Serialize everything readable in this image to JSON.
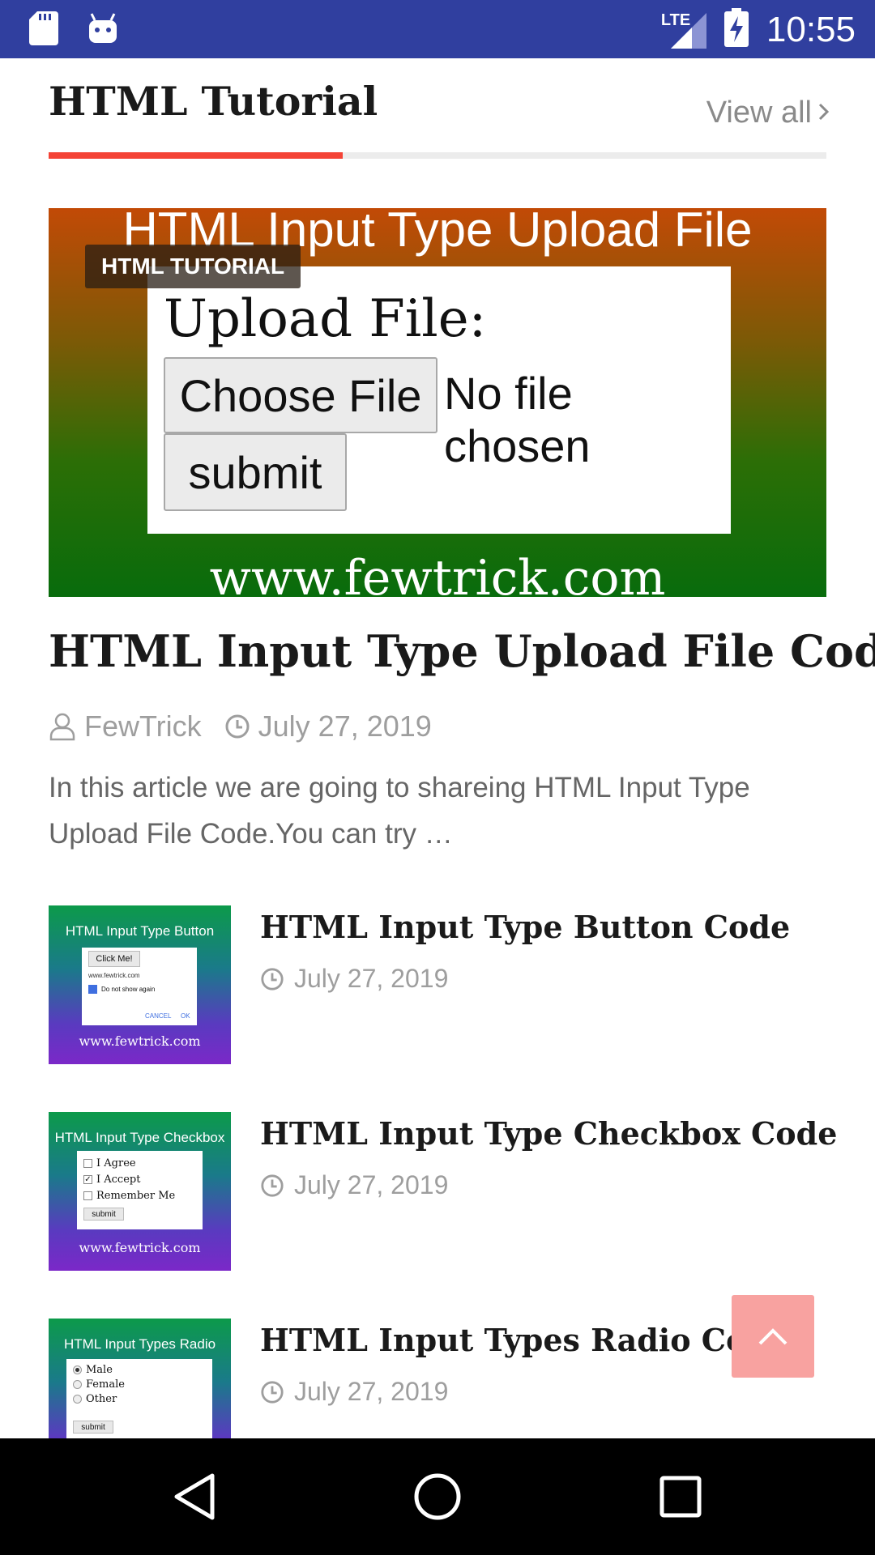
{
  "status_bar": {
    "time": "10:55",
    "network": "LTE"
  },
  "section": {
    "title": "HTML Tutorial",
    "view_all": "View all"
  },
  "featured": {
    "image": {
      "top_text": "HTML Input Type Upload File",
      "label": "Upload File:",
      "choose_button": "Choose File",
      "no_file": "No file chosen",
      "submit": "submit",
      "site": "www.fewtrick.com"
    },
    "category": "HTML TUTORIAL",
    "title": "HTML Input Type Upload File Code",
    "author": "FewTrick",
    "date": "July 27, 2019",
    "excerpt": "In this article we are going to shareing HTML Input Type Upload File Code.You can try …"
  },
  "posts": [
    {
      "title": "HTML Input Type Button Code",
      "date": "July 27, 2019",
      "thumb": {
        "title": "HTML Input Type Button",
        "button": "Click Me!",
        "site_small": "www.fewtrick.com",
        "check_label": "Do not show again",
        "cancel": "CANCEL",
        "ok": "OK",
        "site": "www.fewtrick.com"
      }
    },
    {
      "title": "HTML Input Type Checkbox Code",
      "date": "July 27, 2019",
      "thumb": {
        "title": "HTML Input Type Checkbox",
        "options": [
          "I Agree",
          "I Accept",
          "Remember Me"
        ],
        "submit": "submit",
        "site": "www.fewtrick.com"
      }
    },
    {
      "title": "HTML Input Types Radio Code",
      "date": "July 27, 2019",
      "thumb": {
        "title": "HTML Input Types Radio",
        "options": [
          "Male",
          "Female",
          "Other"
        ],
        "submit": "submit"
      }
    }
  ],
  "colors": {
    "status_bar": "#303F9F",
    "accent": "#f44336",
    "back_to_top": "#f8a2a0"
  }
}
